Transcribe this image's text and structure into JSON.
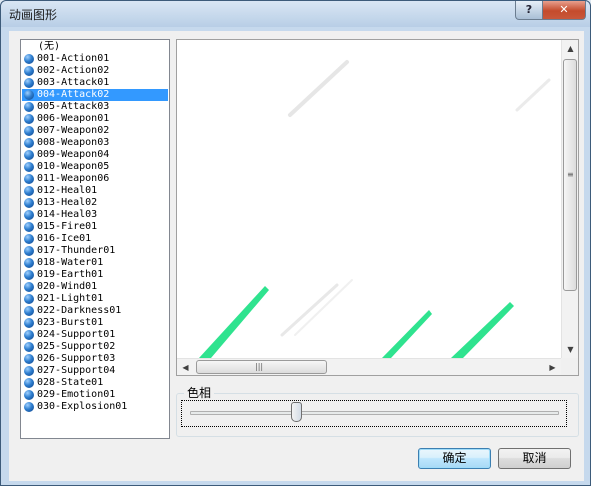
{
  "window": {
    "title": "动画图形",
    "help_label": "?",
    "close_label": "✕"
  },
  "list": {
    "items": [
      {
        "label": "(无)",
        "icon": false
      },
      {
        "label": "001-Action01",
        "icon": true
      },
      {
        "label": "002-Action02",
        "icon": true
      },
      {
        "label": "003-Attack01",
        "icon": true
      },
      {
        "label": "004-Attack02",
        "icon": true,
        "selected": true
      },
      {
        "label": "005-Attack03",
        "icon": true
      },
      {
        "label": "006-Weapon01",
        "icon": true
      },
      {
        "label": "007-Weapon02",
        "icon": true
      },
      {
        "label": "008-Weapon03",
        "icon": true
      },
      {
        "label": "009-Weapon04",
        "icon": true
      },
      {
        "label": "010-Weapon05",
        "icon": true
      },
      {
        "label": "011-Weapon06",
        "icon": true
      },
      {
        "label": "012-Heal01",
        "icon": true
      },
      {
        "label": "013-Heal02",
        "icon": true
      },
      {
        "label": "014-Heal03",
        "icon": true
      },
      {
        "label": "015-Fire01",
        "icon": true
      },
      {
        "label": "016-Ice01",
        "icon": true
      },
      {
        "label": "017-Thunder01",
        "icon": true
      },
      {
        "label": "018-Water01",
        "icon": true
      },
      {
        "label": "019-Earth01",
        "icon": true
      },
      {
        "label": "020-Wind01",
        "icon": true
      },
      {
        "label": "021-Light01",
        "icon": true
      },
      {
        "label": "022-Darkness01",
        "icon": true
      },
      {
        "label": "023-Burst01",
        "icon": true
      },
      {
        "label": "024-Support01",
        "icon": true
      },
      {
        "label": "025-Support02",
        "icon": true
      },
      {
        "label": "026-Support03",
        "icon": true
      },
      {
        "label": "027-Support04",
        "icon": true
      },
      {
        "label": "028-State01",
        "icon": true
      },
      {
        "label": "029-Emotion01",
        "icon": true
      },
      {
        "label": "030-Explosion01",
        "icon": true
      }
    ],
    "icon_name": "blue-orb-icon"
  },
  "preview": {
    "up_arrow": "▲",
    "down_arrow": "▼",
    "left_arrow": "◀",
    "right_arrow": "▶",
    "v_grip": "≡",
    "h_grip": "|||",
    "slash_color": "#2fe38f"
  },
  "hue": {
    "label": "色相",
    "value_fraction": 0.29
  },
  "buttons": {
    "ok_label": "确定",
    "cancel_label": "取消"
  }
}
